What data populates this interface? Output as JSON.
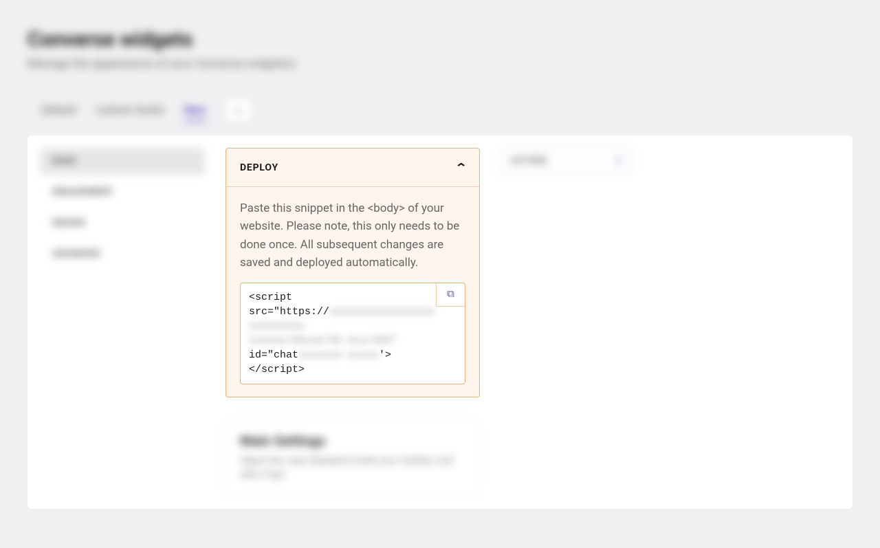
{
  "header": {
    "title": "Converse widgets",
    "subtitle": "Manage the appearance of your Converse widget(s)"
  },
  "tabs": {
    "items": [
      {
        "label": "Default",
        "active": false
      },
      {
        "label": "custom footer",
        "active": false
      },
      {
        "label": "New",
        "active": true
      }
    ],
    "add_label": "+"
  },
  "sidebar": {
    "items": [
      {
        "label": "MAIN",
        "selected": true
      },
      {
        "label": "ENGAGEMENT",
        "selected": false
      },
      {
        "label": "DESIGN",
        "selected": false
      },
      {
        "label": "ADVANCED",
        "selected": false
      }
    ]
  },
  "deploy": {
    "title": "DEPLOY",
    "description": "Paste this snippet in the <body> of your website. Please note, this only needs to be done once. All subsequent changes are saved and deployed automatically.",
    "snippet": {
      "line1_a": "<script",
      "line2_a": "src=\"https://",
      "line2_b": "xxxxxxxxxxxxxxxxx",
      "line3_blur": "xxxxxxxxx",
      "line4_blur": "xxxxxx/XXxxX/XX.Xxx/XXX\"",
      "line5_a": "id=\"chat",
      "line5_b": "xxxxxxx-xxxxx",
      "line5_c": "'>",
      "line6": "</script>"
    }
  },
  "settings_card": {
    "title": "Main Settings",
    "description": "Adjust the copy displayed inside your chatbot, and add a logo."
  },
  "actions": {
    "label": "ACTIONS"
  }
}
